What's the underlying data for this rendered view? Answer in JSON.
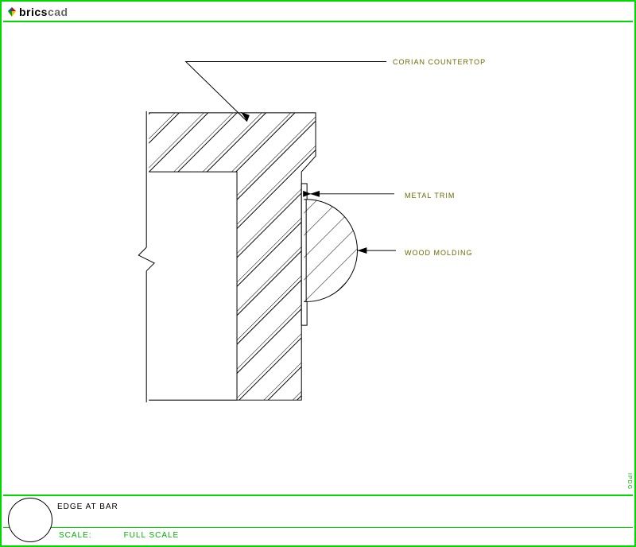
{
  "brand": {
    "brics": "brics",
    "cad": "cad"
  },
  "labels": {
    "corian": "CORIAN COUNTERTOP",
    "metal": "METAL TRIM",
    "wood": "WOOD MOLDING"
  },
  "footer": {
    "title": "EDGE AT BAR",
    "scale_label": "SCALE:",
    "scale_value": "FULL SCALE"
  },
  "sidetext": "IPDG"
}
